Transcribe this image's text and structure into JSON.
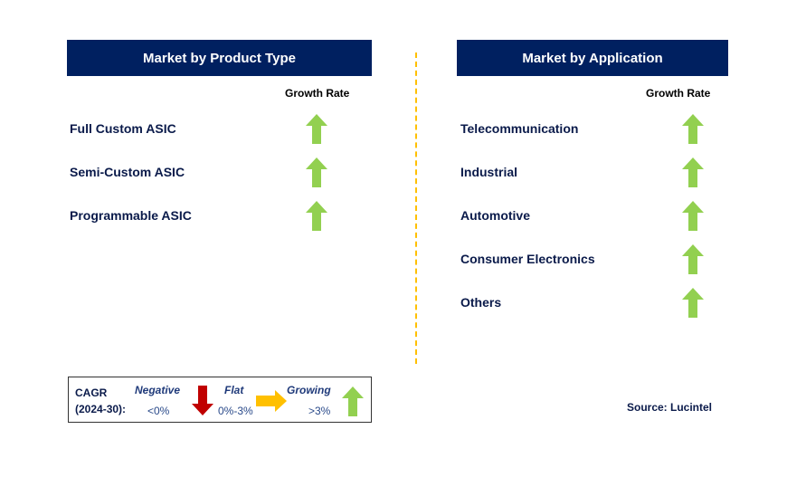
{
  "left": {
    "title": "Market by Product Type",
    "growth_label": "Growth Rate",
    "items": [
      {
        "label": "Full Custom ASIC",
        "trend": "growing"
      },
      {
        "label": "Semi-Custom ASIC",
        "trend": "growing"
      },
      {
        "label": "Programmable ASIC",
        "trend": "growing"
      }
    ]
  },
  "right": {
    "title": "Market by Application",
    "growth_label": "Growth Rate",
    "items": [
      {
        "label": "Telecommunication",
        "trend": "growing"
      },
      {
        "label": "Industrial",
        "trend": "growing"
      },
      {
        "label": "Automotive",
        "trend": "growing"
      },
      {
        "label": "Consumer Electronics",
        "trend": "growing"
      },
      {
        "label": "Others",
        "trend": "growing"
      }
    ]
  },
  "legend": {
    "cagr": "CAGR",
    "period": "(2024-30):",
    "negative": "Negative",
    "negative_range": "<0%",
    "flat": "Flat",
    "flat_range": "0%-3%",
    "growing": "Growing",
    "growing_range": ">3%"
  },
  "source": "Source: Lucintel",
  "colors": {
    "header": "#002060",
    "growing": "#92D050",
    "negative": "#C00000",
    "flat": "#FFC000"
  }
}
